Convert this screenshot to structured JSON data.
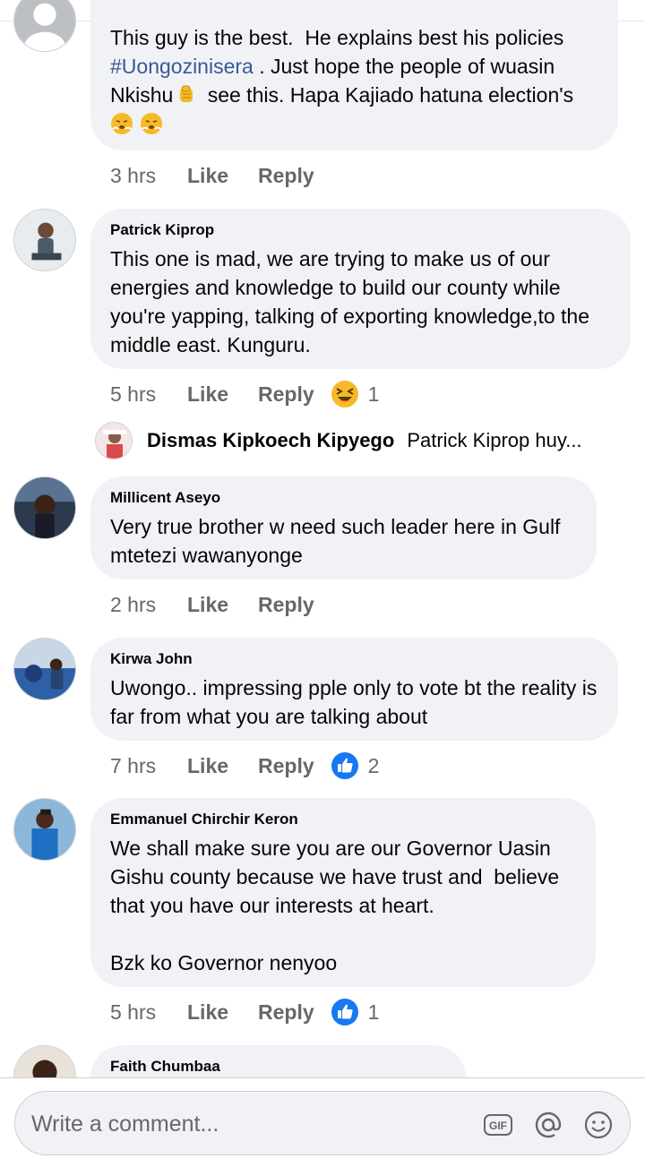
{
  "comments": [
    {
      "text_part1": "This guy is the best.  He explains best his policies ",
      "hashtag": "#Uongozinisera",
      "text_part2": " . Just hope the people of wuasin Nkishu",
      "text_part3": " see this. Hapa Kajiado hatuna election's",
      "time": "3 hrs",
      "like": "Like",
      "reply": "Reply"
    },
    {
      "name": "Patrick Kiprop",
      "text": "This one is mad, we are trying to make us of our energies and knowledge to build our county while you're yapping, talking of exporting knowledge,to the middle east. Kunguru.",
      "time": "5 hrs",
      "like": "Like",
      "reply": "Reply",
      "reaction": "laughing-emoji",
      "reaction_count": "1"
    },
    {
      "name": "Millicent Aseyo",
      "text": "Very true brother w need such leader here in Gulf mtetezi wawanyonge",
      "time": "2 hrs",
      "like": "Like",
      "reply": "Reply"
    },
    {
      "name": "Kirwa John",
      "text": "Uwongo.. impressing pple only to vote bt the reality is far from what you are talking about",
      "time": "7 hrs",
      "like": "Like",
      "reply": "Reply",
      "reaction": "thumbs-up",
      "reaction_count": "2"
    },
    {
      "name": "Emmanuel Chirchir Keron",
      "text": "We shall make sure you are our Governor Uasin Gishu county because we have trust and  believe that you have our interests at heart.\n\nBzk ko Governor nenyoo",
      "time": "5 hrs",
      "like": "Like",
      "reply": "Reply",
      "reaction": "thumbs-up",
      "reaction_count": "1"
    },
    {
      "name": "Faith Chumbaa"
    }
  ],
  "reply_preview": {
    "name": "Dismas Kipkoech Kipyego",
    "text": "Patrick Kiprop huy..."
  },
  "composer": {
    "placeholder": "Write a comment...",
    "icons": [
      "gif-icon",
      "at-mention-icon",
      "emoji-icon"
    ]
  },
  "colors": {
    "bubble": "#f0f2f5",
    "hashtag": "#385898",
    "secondary_text": "#65676b",
    "like_blue": "#1877f2",
    "haha_yellow": "#f7b928"
  }
}
